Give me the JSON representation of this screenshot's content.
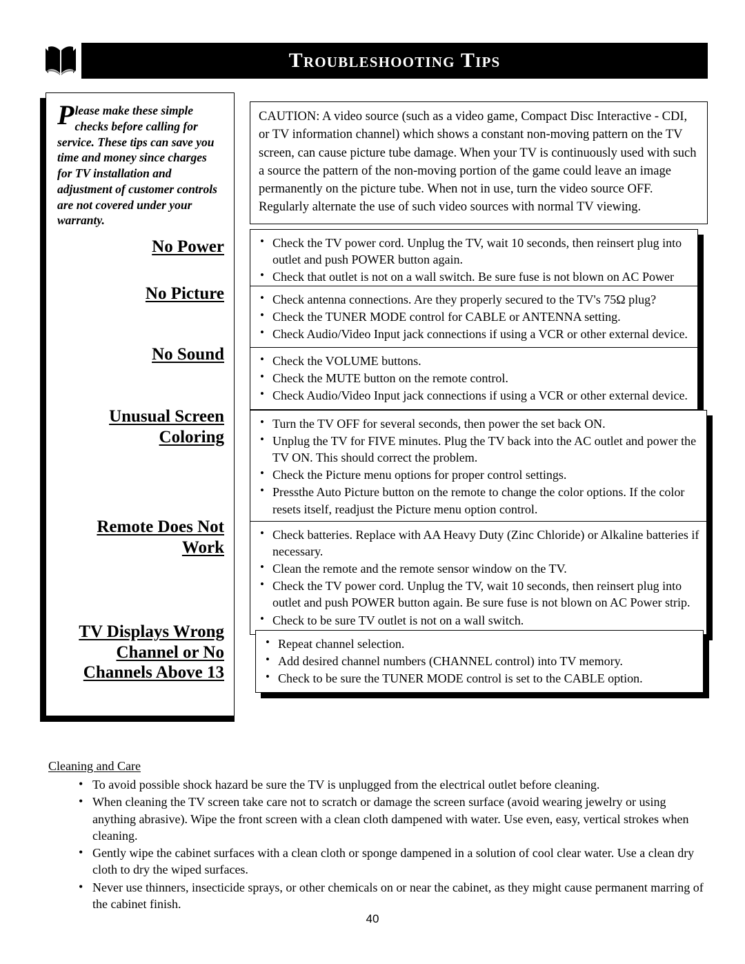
{
  "header": {
    "icon": "open-book-icon",
    "title": "Troubleshooting Tips"
  },
  "sidebar": {
    "intro_dropcap": "P",
    "intro_text": "lease make these simple checks before calling for service. These tips can save you time and money since charges for TV installation and adjustment of customer controls are not covered under your warranty.",
    "headings": [
      {
        "label": "No Power"
      },
      {
        "label": "No Picture"
      },
      {
        "label": "No Sound"
      },
      {
        "label": "Unusual Screen\nColoring"
      },
      {
        "label": "Remote Does Not\nWork"
      },
      {
        "label": "TV Displays Wrong\nChannel or No\nChannels Above 13"
      }
    ]
  },
  "caution": {
    "text": "CAUTION: A video source (such as a video game, Compact Disc Interactive - CDI, or TV information channel) which shows a constant non-moving pattern on the TV screen, can cause picture tube damage.  When your TV is continuously used with such a source the pattern of the non-moving portion of the game could leave an image permanently on the picture tube.  When not in use, turn the video source OFF.  Regularly alternate the use of such video sources with normal TV viewing."
  },
  "panels": [
    {
      "name": "no-power",
      "items": [
        "Check the TV power cord.  Unplug the TV, wait 10 seconds, then reinsert plug into outlet and push POWER button again.",
        "Check that outlet is not on a wall switch. Be sure fuse is not blown on AC Power strip."
      ]
    },
    {
      "name": "no-picture",
      "items": [
        "Check antenna connections.  Are they properly secured to the TV's 75Ω plug?",
        "Check the TUNER MODE control for CABLE or ANTENNA setting.",
        "Check Audio/Video Input jack connections if using a VCR or other external device."
      ]
    },
    {
      "name": "no-sound",
      "items": [
        "Check the VOLUME buttons.",
        "Check the MUTE button on the remote control.",
        "Check Audio/Video Input jack connections if using a VCR or other external device."
      ]
    },
    {
      "name": "unusual-screen-coloring",
      "items": [
        "Turn the TV OFF for several seconds, then power the set back ON.",
        "Unplug the TV for FIVE minutes. Plug the TV back into the AC outlet and power the TV ON. This should correct the problem.",
        "Check the Picture menu options for proper control settings.",
        "Pressthe Auto Picture button on the remote to change the color options. If the color resets itself, readjust the Picture menu option control."
      ]
    },
    {
      "name": "remote-does-not-work",
      "items": [
        "Check batteries.  Replace with AA Heavy Duty (Zinc Chloride) or Alkaline batteries if necessary.",
        "Clean the remote and the remote sensor window on the TV.",
        "Check the TV power cord.  Unplug the TV, wait 10 seconds, then reinsert plug into outlet and push POWER button again. Be sure fuse is not blown on AC Power strip.",
        "Check to be sure TV outlet is not on a wall switch."
      ]
    },
    {
      "name": "tv-displays-wrong-channel",
      "items": [
        "Repeat channel selection.",
        "Add desired channel numbers (CHANNEL control) into TV memory.",
        "Check to be sure the TUNER MODE control is set to the CABLE option."
      ]
    }
  ],
  "care": {
    "title": "Cleaning and Care",
    "items": [
      "To avoid possible shock hazard be sure the TV is unplugged from the electrical outlet before cleaning.",
      "When cleaning the TV screen take care not to scratch or damage the screen surface (avoid wearing jewelry or using anything abrasive). Wipe the front screen with a clean cloth dampened with water. Use even, easy, vertical strokes when cleaning.",
      "Gently wipe the cabinet surfaces with a clean cloth or sponge dampened in a solution of cool clear water. Use a clean dry cloth to dry the wiped surfaces.",
      "Never use thinners, insecticide sprays, or other chemicals on or near the cabinet, as they might cause permanent marring of the cabinet finish."
    ]
  },
  "footer": {
    "page_number": "40"
  },
  "colors": {
    "ink": "#000000",
    "paper": "#ffffff",
    "title_bar_bg": "#000000",
    "title_bar_fg": "#ffffff"
  }
}
